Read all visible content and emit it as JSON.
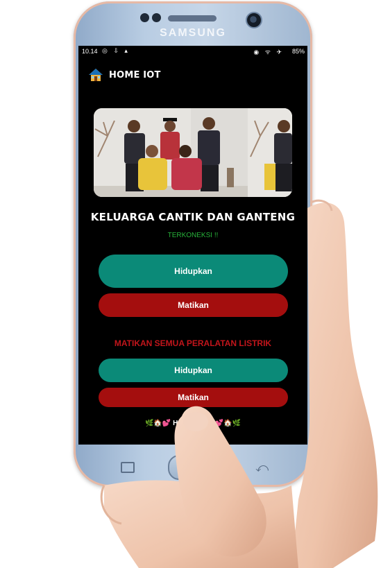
{
  "device": {
    "brand": "SAMSUNG"
  },
  "statusbar": {
    "time": "10.14",
    "battery": "85%",
    "left_icons": "◎ ⇩ ▴",
    "right_icons": "◉ ᯤ ✈"
  },
  "appbar": {
    "title": "HOME IOT",
    "icon": "house-icon"
  },
  "hero": {
    "alt": "family-photo"
  },
  "main": {
    "family_title": "KELUARGA CANTIK DAN GANTENG",
    "connection_status": "TERKONEKSI !!",
    "on_button_1": "Hidupkan",
    "off_button_1": "Matikan",
    "section_label": "MATIKAN SEMUA PERALATAN LISTRIK",
    "on_button_2": "Hidupkan",
    "off_button_2": "Matikan",
    "footer": "🌿🏠💕 HOME ... ER 💕🏠🌿"
  },
  "colors": {
    "on": "#0b8a78",
    "off": "#a40e0e",
    "connected": "#27b23a",
    "section": "#c2151b"
  }
}
